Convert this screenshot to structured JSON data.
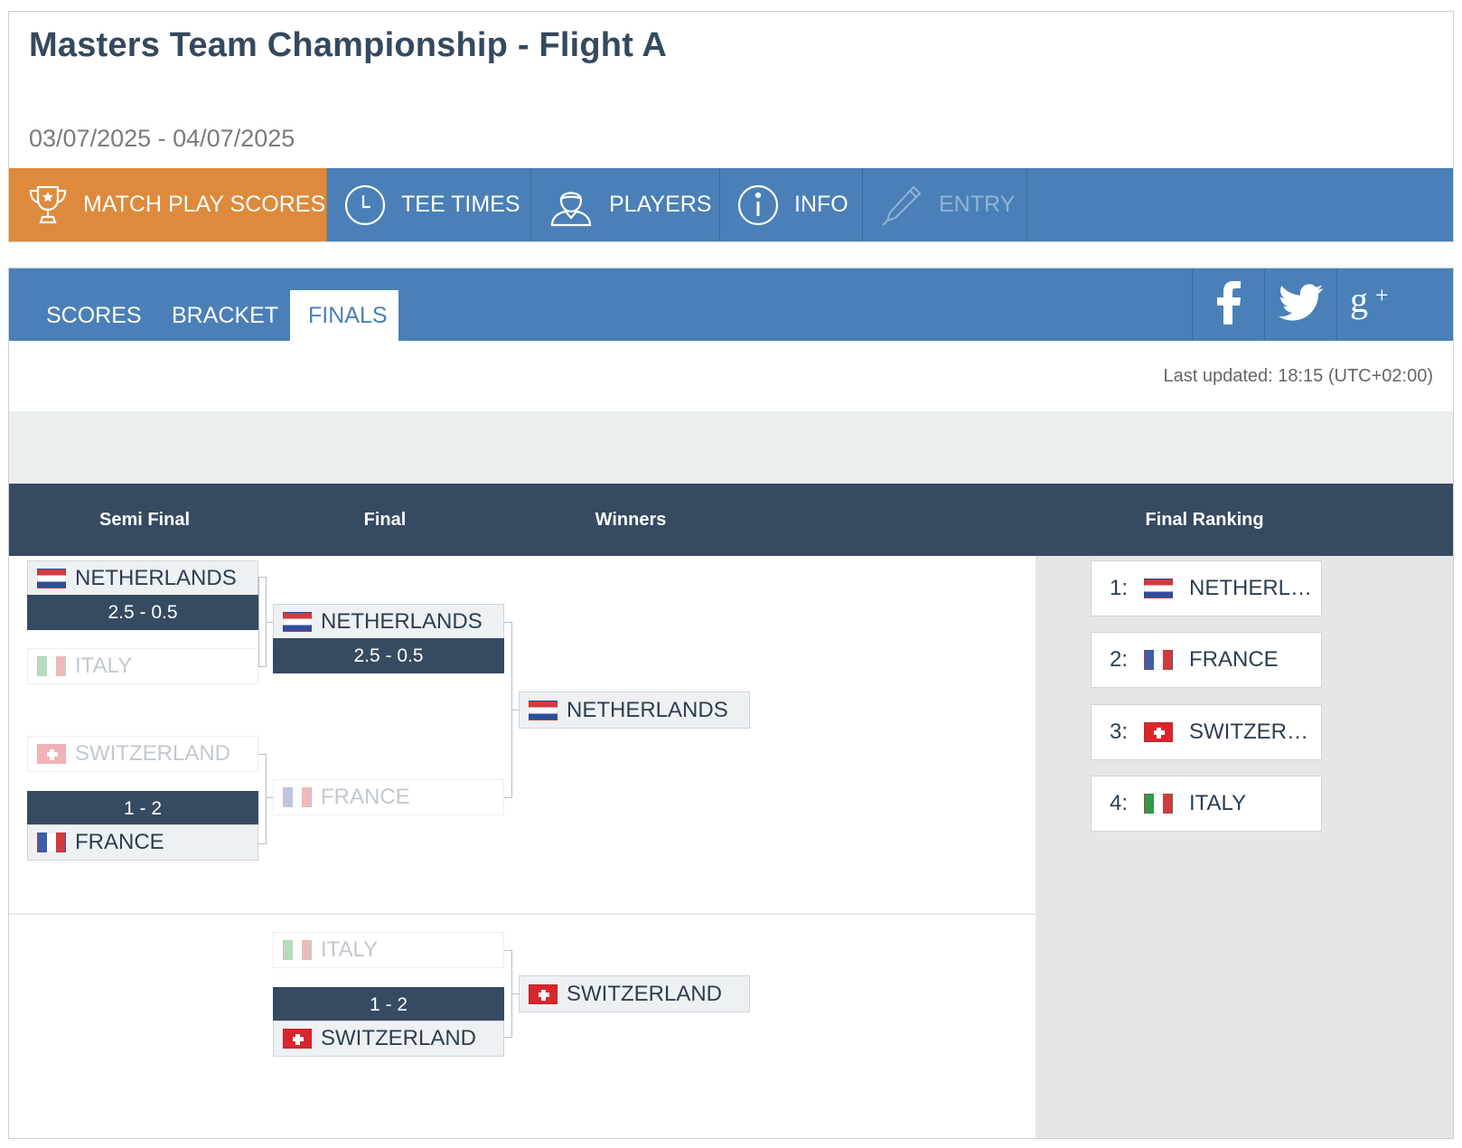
{
  "header": {
    "title": "Masters Team Championship - Flight A",
    "dates": "03/07/2025 - 04/07/2025"
  },
  "main_nav": [
    {
      "label": "MATCH PLAY SCORES",
      "icon": "trophy-icon",
      "active": true
    },
    {
      "label": "TEE TIMES",
      "icon": "clock-icon"
    },
    {
      "label": "PLAYERS",
      "icon": "player-icon"
    },
    {
      "label": "INFO",
      "icon": "info-icon"
    },
    {
      "label": "ENTRY",
      "icon": "pencil-icon",
      "disabled": true
    }
  ],
  "sub_tabs": [
    {
      "label": "SCORES"
    },
    {
      "label": "BRACKET"
    },
    {
      "label": "FINALS",
      "active": true
    }
  ],
  "social": [
    "facebook-icon",
    "twitter-icon",
    "google-plus-icon"
  ],
  "last_updated": "Last updated: 18:15 (UTC+02:00)",
  "columns": {
    "semi_final": "Semi Final",
    "final": "Final",
    "winners": "Winners",
    "final_ranking": "Final Ranking"
  },
  "semi_finals": [
    {
      "top": {
        "team": "NETHERLANDS",
        "flag": "nl"
      },
      "score": "2.5 - 0.5",
      "bottom": {
        "team": "ITALY",
        "flag": "it"
      },
      "winner": "top"
    },
    {
      "top": {
        "team": "SWITZERLAND",
        "flag": "ch"
      },
      "score": "1 - 2",
      "bottom": {
        "team": "FRANCE",
        "flag": "fr"
      },
      "winner": "bottom"
    }
  ],
  "final": {
    "top": {
      "team": "NETHERLANDS",
      "flag": "nl"
    },
    "score": "2.5 - 0.5",
    "bottom": {
      "team": "FRANCE",
      "flag": "fr"
    },
    "winner": "top"
  },
  "winner": {
    "team": "NETHERLANDS",
    "flag": "nl"
  },
  "third_place": {
    "top": {
      "team": "ITALY",
      "flag": "it"
    },
    "score": "1 - 2",
    "bottom": {
      "team": "SWITZERLAND",
      "flag": "ch"
    },
    "winner": "bottom"
  },
  "third_place_winner": {
    "team": "SWITZERLAND",
    "flag": "ch"
  },
  "ranking": [
    {
      "pos": "1:",
      "team": "NETHERL…",
      "flag": "nl"
    },
    {
      "pos": "2:",
      "team": "FRANCE",
      "flag": "fr"
    },
    {
      "pos": "3:",
      "team": "SWITZER…",
      "flag": "ch"
    },
    {
      "pos": "4:",
      "team": "ITALY",
      "flag": "it"
    }
  ],
  "colors": {
    "nav_blue": "#4a80b7",
    "active_orange": "#de8a3c",
    "header_dark": "#364a62",
    "ranking_bg": "#e6e6e6"
  }
}
